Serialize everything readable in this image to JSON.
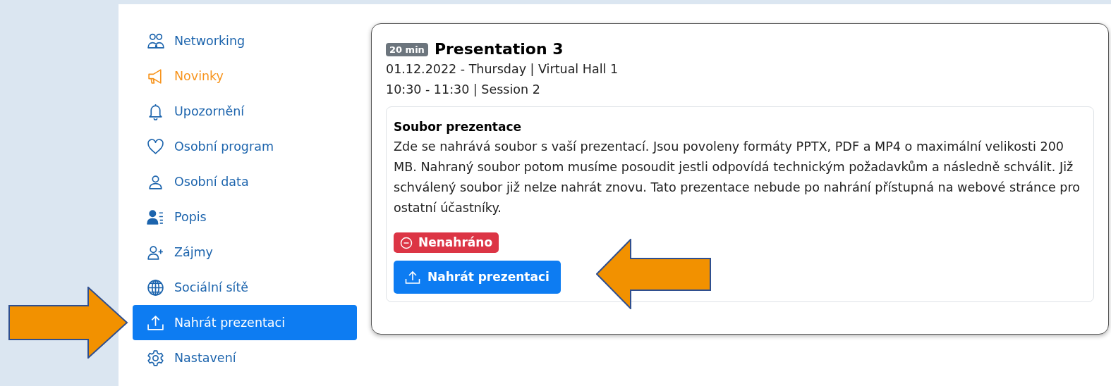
{
  "sidebar": {
    "items": [
      {
        "label": "Networking",
        "selected": false,
        "new": false
      },
      {
        "label": "Novinky",
        "selected": false,
        "new": true
      },
      {
        "label": "Upozornění",
        "selected": false,
        "new": false
      },
      {
        "label": "Osobní program",
        "selected": false,
        "new": false
      },
      {
        "label": "Osobní data",
        "selected": false,
        "new": false
      },
      {
        "label": "Popis",
        "selected": false,
        "new": false
      },
      {
        "label": "Zájmy",
        "selected": false,
        "new": false
      },
      {
        "label": "Sociální sítě",
        "selected": false,
        "new": false
      },
      {
        "label": "Nahrát prezentaci",
        "selected": true,
        "new": false
      },
      {
        "label": "Nastavení",
        "selected": false,
        "new": false
      }
    ]
  },
  "presentation": {
    "duration": "20 min",
    "title": "Presentation 3",
    "date_place": "01.12.2022 - Thursday | Virtual Hall 1",
    "time_session": "10:30 - 11:30 | Session 2",
    "file": {
      "heading": "Soubor prezentace",
      "description": "Zde se nahrává soubor s vaší prezentací. Jsou povoleny formáty PPTX, PDF a MP4 o maximální velikosti 200 MB. Nahraný soubor potom musíme posoudit jestli odpovídá technickým požadavkům a následně schválit. Již schválený soubor již nelze nahrát znovu. Tato prezentace nebude po nahrání přístupná na webové stránce pro ostatní účastníky.",
      "status": {
        "label": "Nenahráno"
      },
      "upload_button": "Nahrát prezentaci"
    }
  }
}
